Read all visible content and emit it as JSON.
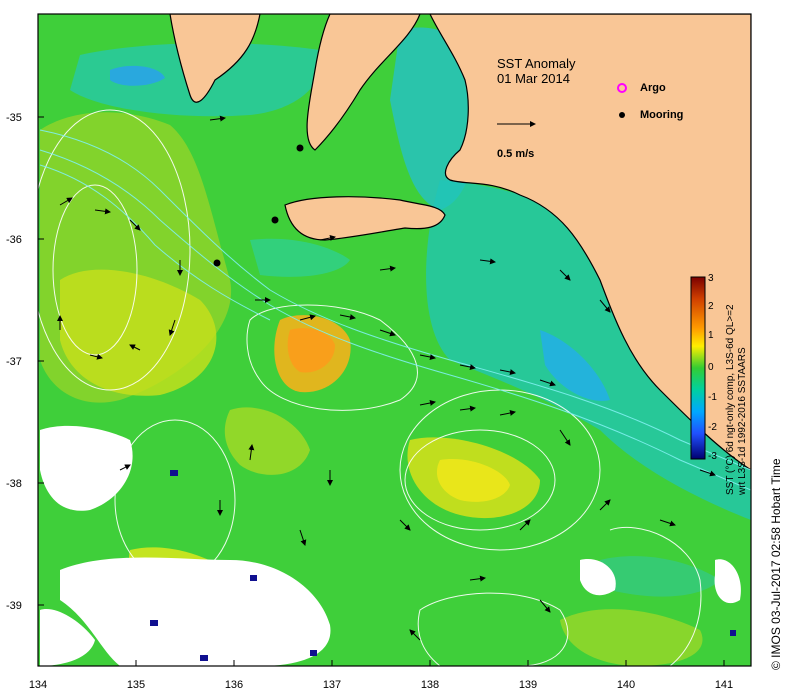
{
  "title": {
    "line1": "SST Anomaly",
    "line2": "01 Mar 2014"
  },
  "legend": {
    "argo_label": "Argo",
    "mooring_label": "Mooring",
    "vector_scale_label": "0.5 m/s"
  },
  "colorbar": {
    "ticks": [
      "3",
      "2",
      "1",
      "0",
      "-1",
      "-2",
      "-3"
    ],
    "label_line1": "SST (°C) 6d ngt-only comp, L3S-6d QL>=2",
    "label_line2": "wrt L3S-1d 1992-2016 SSTAARS"
  },
  "axes": {
    "x_ticks": [
      "134",
      "135",
      "136",
      "137",
      "138",
      "139",
      "140",
      "141"
    ],
    "y_ticks": [
      "-35",
      "-36",
      "-37",
      "-38",
      "-39"
    ]
  },
  "credit": "© IMOS 03-Jul-2017 02:58 Hobart Time",
  "moorings": [
    {
      "lon": 136.7,
      "lat": -35.25
    },
    {
      "lon": 136.4,
      "lat": -35.85
    },
    {
      "lon": 135.85,
      "lat": -36.18
    }
  ],
  "colors": {
    "land": "#f9c696",
    "ocean_base": "#3fcf3a",
    "argo": "#ff00ff",
    "mooring": "#000000"
  }
}
